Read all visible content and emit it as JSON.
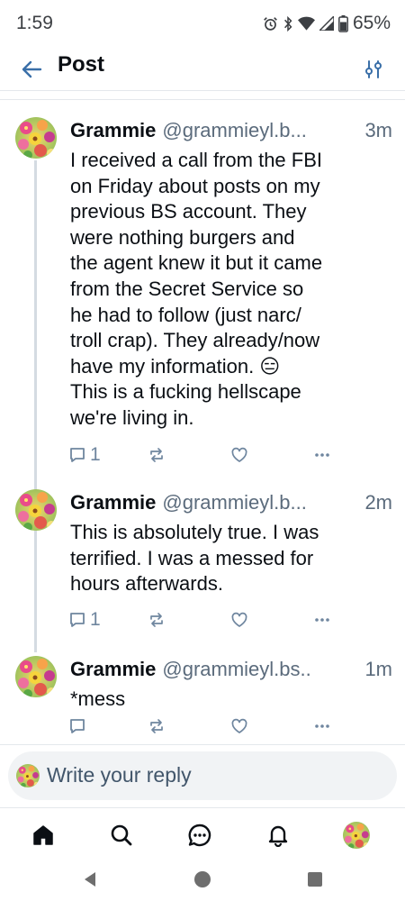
{
  "status_bar": {
    "time": "1:59",
    "battery": "65%",
    "icons": [
      "alarm-icon",
      "bluetooth-icon",
      "wifi-icon",
      "signal-icon",
      "battery-icon"
    ]
  },
  "header": {
    "title": "Post",
    "back_icon": "arrow-left-icon",
    "settings_icon": "sliders-icon"
  },
  "posts": [
    {
      "name": "Grammie",
      "handle": "@grammieyl.b...",
      "time": "3m",
      "text": "I received a call from the FBI\non Friday about posts on my\nprevious BS account. They\nwere nothing burgers and\nthe agent knew it but it came\nfrom the Secret Service so\nhe had to follow (just narc/\ntroll crap). They already/now\nhave my information. 😑\nThis is a fucking hellscape\nwe're living in.",
      "reply_count": "1"
    },
    {
      "name": "Grammie",
      "handle": "@grammieyl.b...",
      "time": "2m",
      "text": "This is absolutely true. I was\nterrified. I was a messed for\nhours afterwards.",
      "reply_count": "1"
    },
    {
      "name": "Grammie",
      "handle": "@grammieyl.bs..",
      "time": "1m",
      "text": "*mess",
      "reply_count": ""
    }
  ],
  "reply": {
    "placeholder": "Write your reply"
  },
  "bottom_nav": {
    "items": [
      "home-icon",
      "search-icon",
      "chat-icon",
      "bell-icon",
      "profile-avatar"
    ]
  },
  "colors": {
    "accent": "#6f869f",
    "text": "#0b0f14",
    "muted": "#5b6b7c",
    "thread_line": "#d4dbe2",
    "reply_bg": "#f1f3f5"
  }
}
